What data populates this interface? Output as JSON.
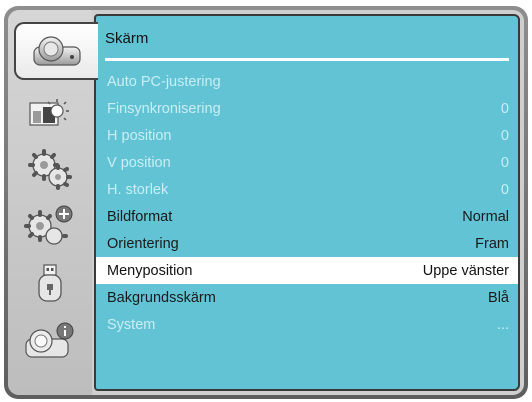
{
  "panel": {
    "title": "Skärm"
  },
  "menu": {
    "items": [
      {
        "label": "Auto PC-justering",
        "value": "",
        "state": "disabled"
      },
      {
        "label": "Finsynkronisering",
        "value": "0",
        "state": "disabled"
      },
      {
        "label": "H position",
        "value": "0",
        "state": "disabled"
      },
      {
        "label": "V position",
        "value": "0",
        "state": "disabled"
      },
      {
        "label": "H. storlek",
        "value": "0",
        "state": "disabled"
      },
      {
        "label": "Bildformat",
        "value": "Normal",
        "state": "enabled"
      },
      {
        "label": "Orientering",
        "value": "Fram",
        "state": "enabled"
      },
      {
        "label": "Menyposition",
        "value": "Uppe vänster",
        "state": "selected"
      },
      {
        "label": "Bakgrundsskärm",
        "value": "Blå",
        "state": "enabled"
      },
      {
        "label": "System",
        "value": "...",
        "state": "disabled"
      }
    ]
  },
  "sidebar": {
    "tabs": [
      {
        "icon": "projector-icon",
        "active": true
      },
      {
        "icon": "picture-brightness-icon",
        "active": false
      },
      {
        "icon": "gears-icon",
        "active": false
      },
      {
        "icon": "gears-plus-icon",
        "active": false
      },
      {
        "icon": "usb-drive-icon",
        "active": false
      },
      {
        "icon": "projector-info-icon",
        "active": false
      }
    ]
  },
  "colors": {
    "panel": "#62c3d5",
    "disabled_text": "#c9eef4",
    "selected_row": "#ffffff",
    "frame": "#6e6e6e"
  }
}
